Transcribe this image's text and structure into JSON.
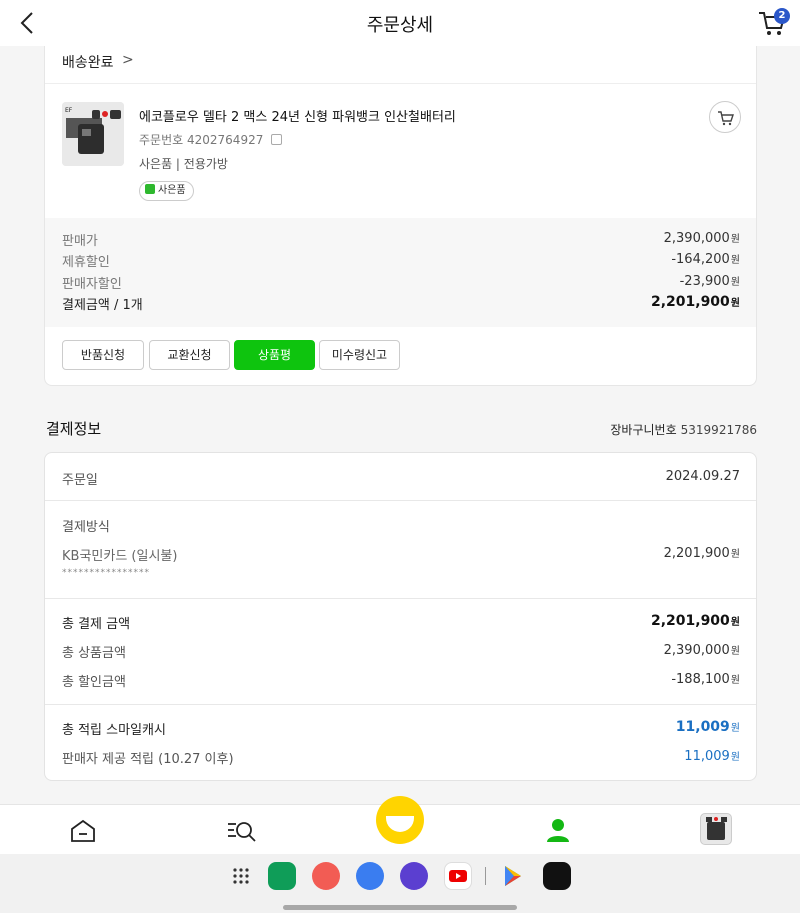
{
  "header": {
    "title": "주문상세",
    "cart_count": "2"
  },
  "order": {
    "status": "배송완료",
    "status_chevron": ">",
    "thumb_brand": "EF",
    "product_name": "에코플로우 델타 2 맥스 24년 신형 파워뱅크 인산철배터리",
    "order_no_label": "주문번호",
    "order_no": "4202764927",
    "option": "사은품 | 전용가방",
    "gift_label": "사은품",
    "prices": [
      {
        "label": "판매가",
        "value": "2,390,000",
        "unit": "원"
      },
      {
        "label": "제휴할인",
        "value": "-164,200",
        "unit": "원"
      },
      {
        "label": "판매자할인",
        "value": "-23,900",
        "unit": "원"
      },
      {
        "label": "결제금액 / 1개",
        "value": "2,201,900",
        "unit": "원"
      }
    ],
    "buttons": {
      "return": "반품신청",
      "exchange": "교환신청",
      "review": "상품평",
      "not_received": "미수령신고"
    }
  },
  "payment": {
    "title": "결제정보",
    "cart_no_label": "장바구니번호",
    "cart_no": "5319921786",
    "order_date_label": "주문일",
    "order_date": "2024.09.27",
    "method_label": "결제방식",
    "method": "KB국민카드 (일시불)",
    "method_amount": "2,201,900",
    "card_masked": "****************",
    "total_label": "총 결제 금액",
    "total": "2,201,900",
    "product_total_label": "총 상품금액",
    "product_total": "2,390,000",
    "discount_total_label": "총 할인금액",
    "discount_total": "-188,100",
    "cash_label": "총 적립 스마일캐시",
    "cash": "11,009",
    "seller_cash_label": "판매자 제공 적립 (10.27 이후)",
    "seller_cash": "11,009",
    "unit": "원"
  },
  "icons": {
    "back": "chevron-left-icon",
    "cart": "cart-icon",
    "home": "home-icon",
    "search": "search-menu-icon",
    "smile": "smile-icon",
    "my": "person-icon"
  },
  "colors": {
    "green": "#0ec40e",
    "blue": "#1a6fc2",
    "badge": "#2b57c9",
    "smile": "#ffd400"
  }
}
